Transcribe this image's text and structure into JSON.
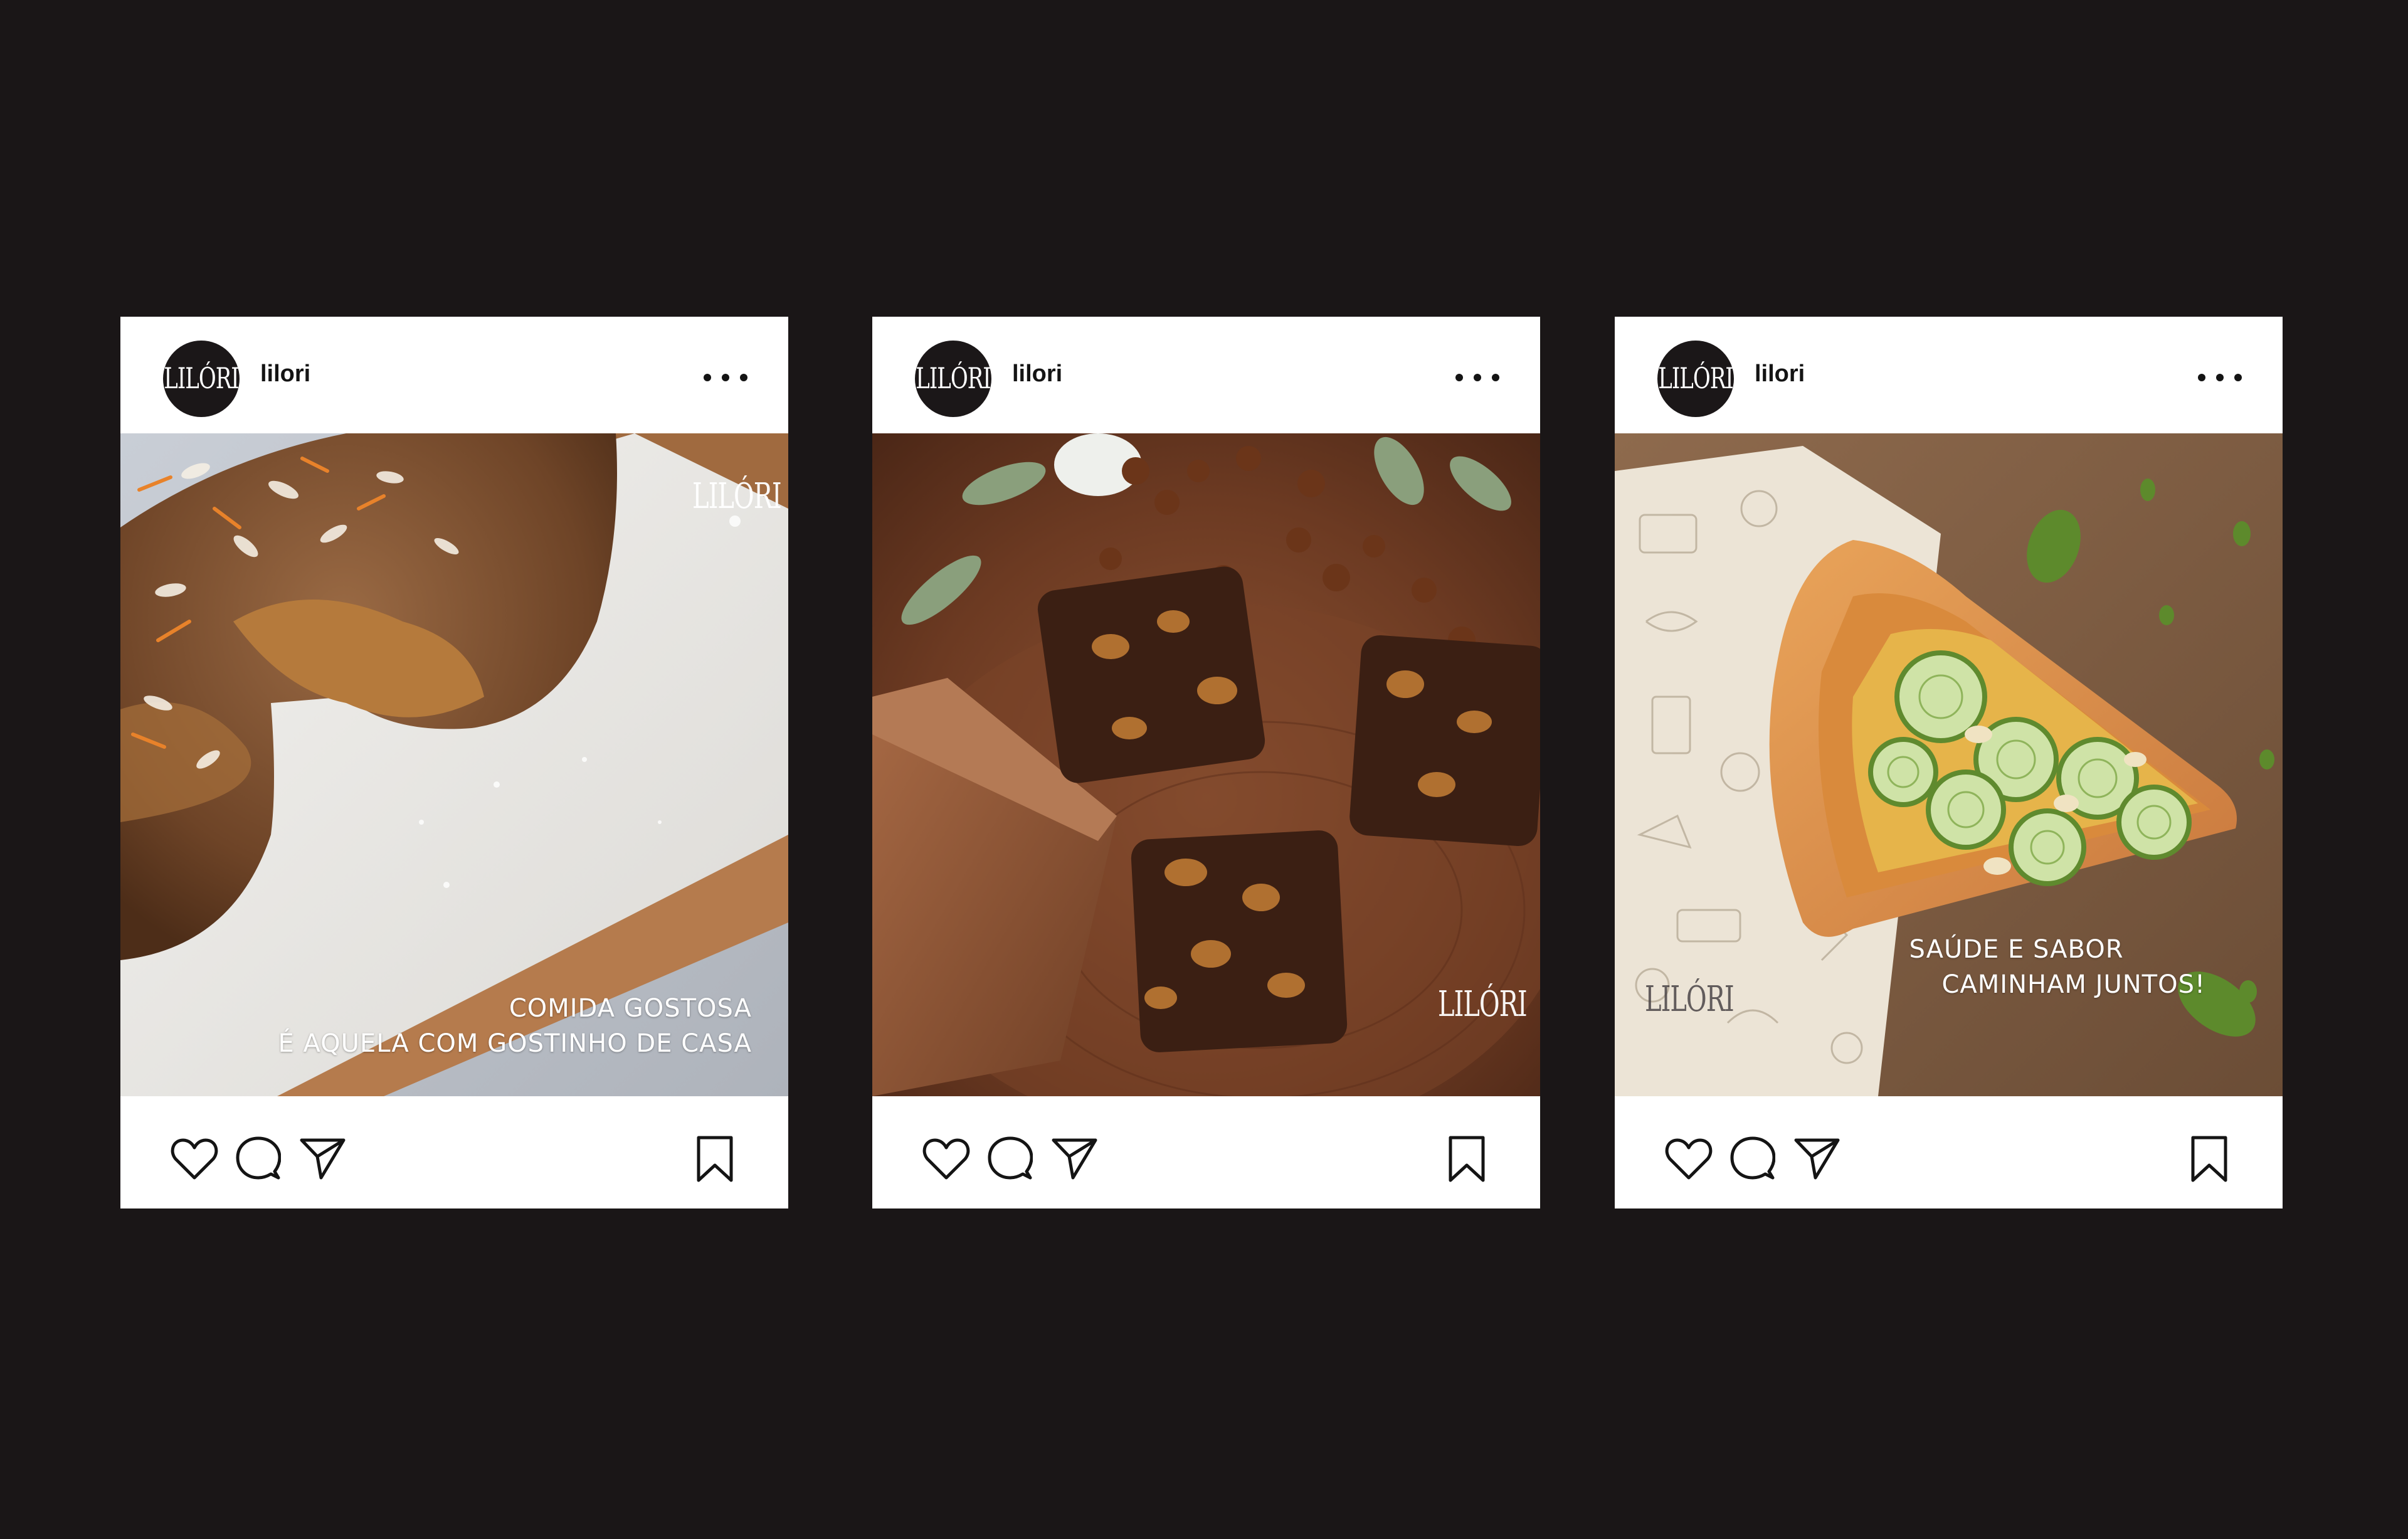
{
  "posts": [
    {
      "username": "lilori",
      "avatar_text": "LILÓRI",
      "watermark": "LILÓRI",
      "caption": [
        "COMIDA GOSTOSA",
        "É AQUELA COM GOSTINHO DE CASA"
      ],
      "photo": "carrot cake slice on parchment and wooden board"
    },
    {
      "username": "lilori",
      "avatar_text": "LILÓRI",
      "watermark": "LILÓRI",
      "caption": [],
      "photo": "chocolate brownies with hazelnuts and chocolate bar"
    },
    {
      "username": "lilori",
      "avatar_text": "LILÓRI",
      "watermark": "LILÓRI",
      "caption": [
        "SAÚDE E SABOR",
        "CAMINHAM JUNTOS!"
      ],
      "photo": "slice of zucchini pizza on kraft paper"
    }
  ],
  "icons": {
    "more": "more-horizontal-icon",
    "like": "heart-icon",
    "comment": "comment-icon",
    "share": "send-icon",
    "save": "bookmark-icon"
  },
  "colors": {
    "background": "#1a1617",
    "card": "#ffffff",
    "avatar": "#1b1718",
    "text": "#141414"
  }
}
